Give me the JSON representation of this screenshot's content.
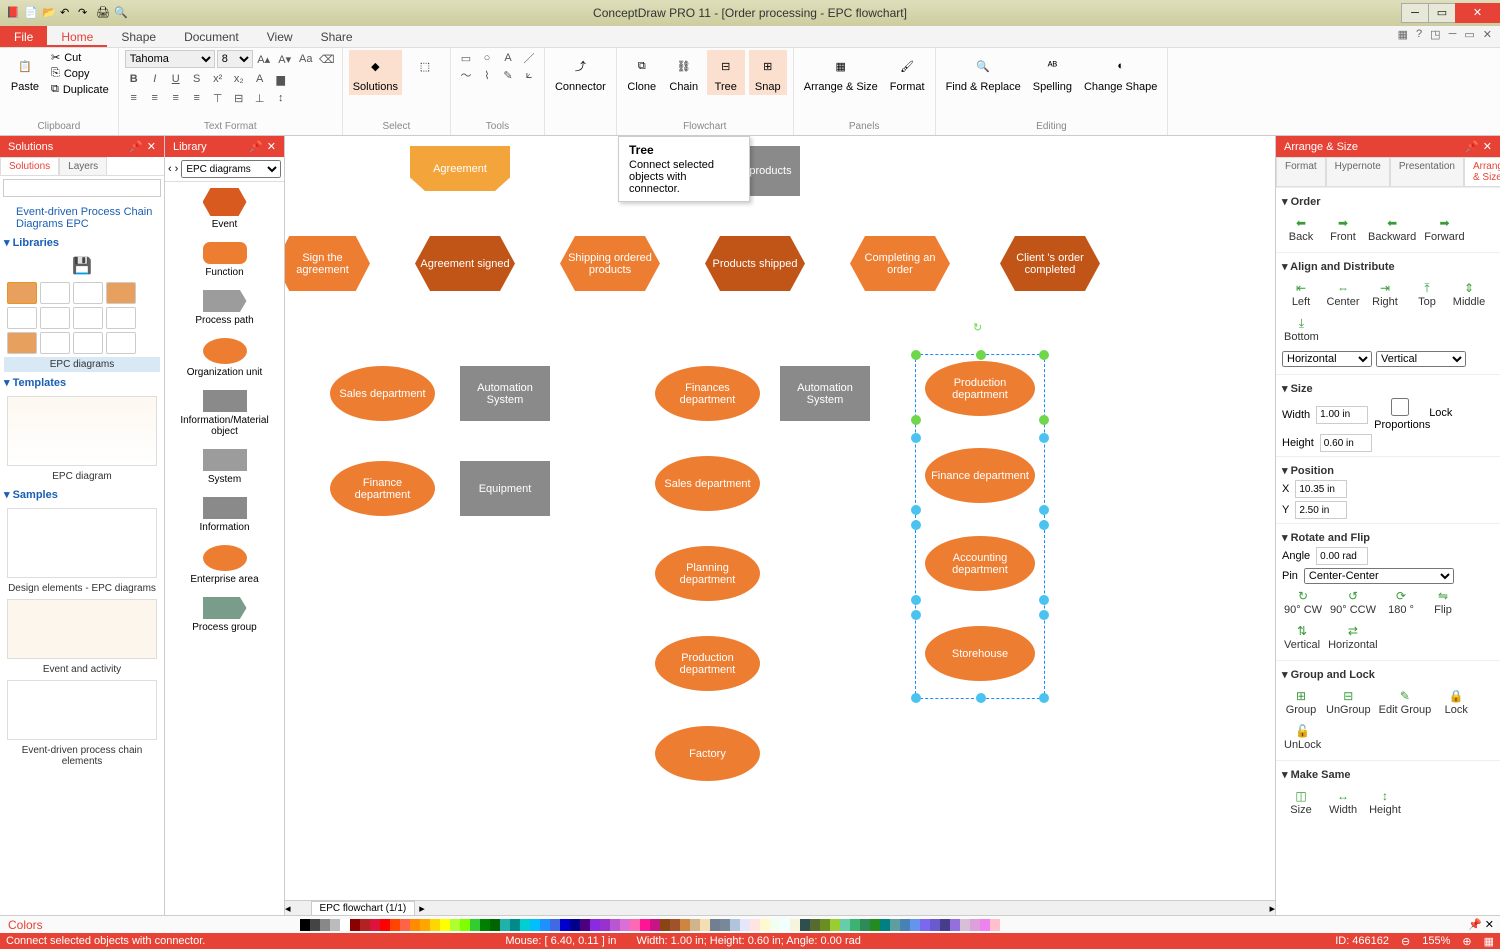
{
  "app_title": "ConceptDraw PRO 11 - [Order processing - EPC flowchart]",
  "menu": {
    "file": "File",
    "tabs": [
      "Home",
      "Shape",
      "Document",
      "View",
      "Share"
    ]
  },
  "ribbon": {
    "clipboard": {
      "paste": "Paste",
      "cut": "Cut",
      "copy": "Copy",
      "duplicate": "Duplicate",
      "label": "Clipboard"
    },
    "textformat": {
      "label": "Text Format",
      "font": "Tahoma",
      "size": "8"
    },
    "solutions": {
      "btn": "Solutions",
      "label": "Select"
    },
    "tools": {
      "label": "Tools"
    },
    "connector": {
      "btn": "Connector"
    },
    "flowchart": {
      "label": "Flowchart",
      "clone": "Clone",
      "chain": "Chain",
      "tree": "Tree",
      "snap": "Snap"
    },
    "panels": {
      "label": "Panels",
      "arrange": "Arrange & Size",
      "format": "Format"
    },
    "editing": {
      "label": "Editing",
      "find": "Find & Replace",
      "spelling": "Spelling",
      "change": "Change Shape"
    }
  },
  "tooltip": {
    "title": "Tree",
    "body": "Connect selected objects with connector."
  },
  "solutions_panel": {
    "title": "Solutions",
    "tabs": [
      "Solutions",
      "Layers"
    ],
    "tree_root": "Event-driven Process Chain Diagrams EPC",
    "sections": [
      "Libraries",
      "Templates",
      "Samples"
    ],
    "thumbs": [
      "EPC diagrams",
      "EPC diagram",
      "Design elements - EPC diagrams",
      "Event and activity",
      "Event-driven process chain elements"
    ]
  },
  "library_panel": {
    "title": "Library",
    "dropdown": "EPC diagrams",
    "items": [
      "Event",
      "Function",
      "Process path",
      "Organization unit",
      "Information/Material object",
      "System",
      "Information",
      "Enterprise area",
      "Process group"
    ]
  },
  "canvas": {
    "tab": "EPC flowchart (1/1)",
    "nodes": {
      "agreement": "Agreement",
      "ordered_products": "ordered products",
      "sign": "Sign the agreement",
      "agreement_signed": "Agreement signed",
      "shipping": "Shipping ordered products",
      "products_shipped": "Products shipped",
      "completing": "Completing an order",
      "client_order": "Client 's order completed",
      "sales_dept": "Sales department",
      "automation": "Automation System",
      "finances_dept": "Finances department",
      "automation2": "Automation System",
      "finance_dept": "Finance department",
      "equipment": "Equipment",
      "sales_dept2": "Sales department",
      "planning_dept": "Planning department",
      "production_dept": "Production department",
      "factory": "Factory",
      "production_dept2": "Production department",
      "finance_dept2": "Finance department",
      "accounting_dept": "Accounting department",
      "storehouse": "Storehouse"
    }
  },
  "arrange_panel": {
    "title": "Arrange & Size",
    "tabs": [
      "Format",
      "Hypernote",
      "Presentation",
      "Arrange & Size"
    ],
    "sections": {
      "order": {
        "h": "Order",
        "btns": [
          "Back",
          "Front",
          "Backward",
          "Forward"
        ]
      },
      "align": {
        "h": "Align and Distribute",
        "btns": [
          "Left",
          "Center",
          "Right",
          "Top",
          "Middle",
          "Bottom"
        ],
        "horiz": "Horizontal",
        "vert": "Vertical"
      },
      "size": {
        "h": "Size",
        "width_l": "Width",
        "width_v": "1.00 in",
        "height_l": "Height",
        "height_v": "0.60 in",
        "lock": "Lock Proportions"
      },
      "position": {
        "h": "Position",
        "x_l": "X",
        "x_v": "10.35 in",
        "y_l": "Y",
        "y_v": "2.50 in"
      },
      "rotate": {
        "h": "Rotate and Flip",
        "angle_l": "Angle",
        "angle_v": "0.00 rad",
        "pin_l": "Pin",
        "pin_v": "Center-Center",
        "btns": [
          "90° CW",
          "90° CCW",
          "180 °",
          "Flip",
          "Vertical",
          "Horizontal"
        ]
      },
      "group": {
        "h": "Group and Lock",
        "btns": [
          "Group",
          "UnGroup",
          "Edit Group",
          "Lock",
          "UnLock"
        ]
      },
      "same": {
        "h": "Make Same",
        "btns": [
          "Size",
          "Width",
          "Height"
        ]
      }
    }
  },
  "colors_label": "Colors",
  "status": {
    "hint": "Connect selected objects with connector.",
    "mouse": "Mouse: [ 6.40, 0.11 ] in",
    "dims": "Width: 1.00 in;  Height: 0.60 in;  Angle: 0.00 rad",
    "id": "ID: 466162",
    "zoom": "155%"
  }
}
